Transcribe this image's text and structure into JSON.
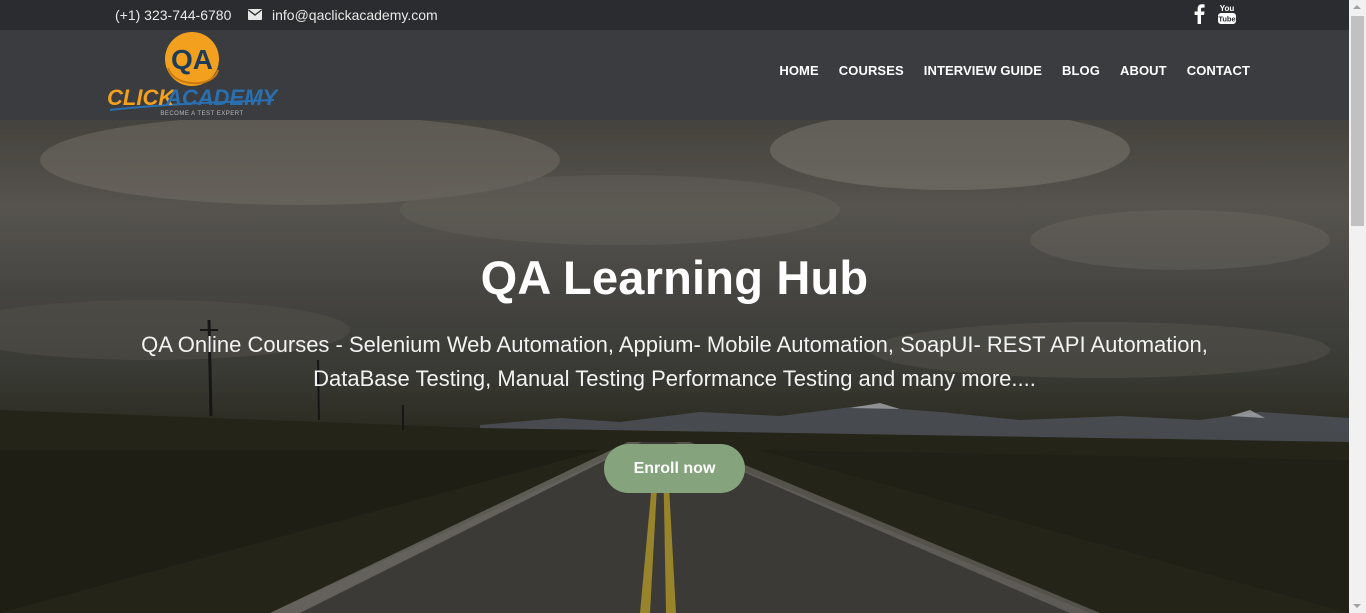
{
  "topbar": {
    "phone": "(+1) 323-744-6780",
    "email": "info@qaclickacademy.com",
    "icons": [
      "mail-icon",
      "facebook-icon",
      "youtube-icon"
    ]
  },
  "logo": {
    "monogram": "QA",
    "word_click": "CLICK",
    "word_academy": "ACADEMY",
    "tagline": "BECOME A TEST EXPERT"
  },
  "nav": {
    "items": [
      {
        "label": "HOME"
      },
      {
        "label": "COURSES"
      },
      {
        "label": "INTERVIEW GUIDE"
      },
      {
        "label": "BLOG"
      },
      {
        "label": "ABOUT"
      },
      {
        "label": "CONTACT"
      }
    ]
  },
  "hero": {
    "title": "QA Learning Hub",
    "subtitle_line1": "QA Online Courses - Selenium Web Automation, Appium- Mobile Automation, SoapUI- REST API Automation,",
    "subtitle_line2": "DataBase Testing, Manual Testing Performance Testing and many more....",
    "cta_label": "Enroll now"
  },
  "colors": {
    "topbar_bg": "#2a2c2f",
    "header_bg": "#3a3c40",
    "cta_bg": "#85a37c",
    "logo_orange": "#f2a01d",
    "logo_blue": "#2a6fb0"
  }
}
